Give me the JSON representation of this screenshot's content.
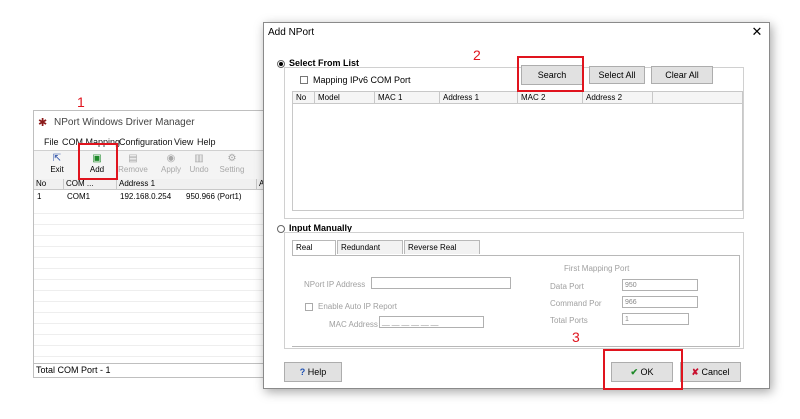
{
  "annotations": {
    "step1": "1",
    "step2": "2",
    "step3": "3"
  },
  "bg_window": {
    "title": "NPort Windows Driver Manager",
    "menu": [
      "File",
      "COM Mapping",
      "Configuration",
      "View",
      "Help"
    ],
    "toolbar": {
      "exit": "Exit",
      "add": "Add",
      "remove": "Remove",
      "apply": "Apply",
      "undo": "Undo",
      "setting": "Setting"
    },
    "columns": [
      "No",
      "COM ...",
      "Address 1",
      "A"
    ],
    "rows": [
      {
        "no": "1",
        "com": "COM1",
        "address": "192.168.0.254",
        "port": "950.966  (Port1)"
      }
    ],
    "status": "Total COM Port - 1"
  },
  "dialog": {
    "title": "Add NPort",
    "close": "✕",
    "select_from_list": "Select From List",
    "mapping_ipv6": "Mapping IPv6 COM Port",
    "search": "Search",
    "select_all": "Select All",
    "clear_all": "Clear All",
    "columns": [
      "No",
      "Model",
      "MAC 1",
      "Address 1",
      "MAC 2",
      "Address 2"
    ],
    "input_manually": "Input Manually",
    "tabs": [
      "Real COM",
      "Redundant COM",
      "Reverse Real COM"
    ],
    "nport_ip_label": "NPort IP Address",
    "enable_auto_ip": "Enable Auto IP Report",
    "mac_label": "MAC Address",
    "mac_value": "__ __ __ __ __ __",
    "first_mapping_port": "First Mapping Port",
    "data_port_label": "Data Port",
    "data_port_value": "950",
    "command_port_label": "Command Por",
    "command_port_value": "966",
    "total_ports_label": "Total Ports",
    "total_ports_value": "1",
    "help": "Help",
    "ok": "OK",
    "cancel": "Cancel"
  }
}
